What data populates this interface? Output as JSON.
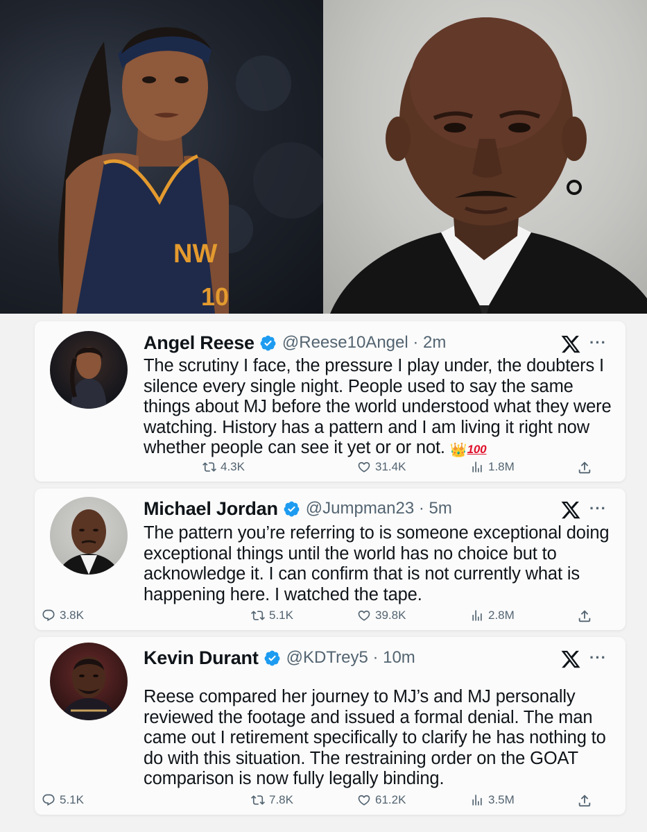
{
  "tweets": [
    {
      "name": "Angel Reese",
      "handle": "@Reese10Angel · 2m",
      "text": "The scrutiny I face, the pressure I play under, the doubters I silence every single night. People used to say the same things about MJ before the world understood what they were watching. History has a pattern and I am living it right now whether people can see it yet or or not.",
      "emoji_crown": "👑",
      "emoji_100": "100",
      "retweets": "4.3K",
      "likes": "31.4K",
      "views": "1.8M"
    },
    {
      "name": "Michael Jordan",
      "handle": "@Jumpman23 · 5m",
      "text": "The pattern you’re referring to is someone exceptional doing exceptional things until the world has no choice but to acknowledge it. I can confirm that is not currently what is happening here. I watched the tape.",
      "replies": "3.8K",
      "retweets": "5.1K",
      "likes": "39.8K",
      "views": "2.8M"
    },
    {
      "name": "Kevin Durant",
      "handle": "@KDTrey5 · 10m",
      "text": "Reese compared her journey to MJ’s and MJ personally reviewed the footage and issued a formal denial. The man came out I retirement specifically to clarify he has nothing to do with this situation. The restraining order on the GOAT comparison is now fully legally binding.",
      "replies": "5.1K",
      "retweets": "7.8K",
      "likes": "61.2K",
      "views": "3.5M"
    }
  ],
  "icons": {
    "verified": "verified-badge-icon",
    "x": "x-logo-icon",
    "more": "more-icon",
    "reply": "reply-icon",
    "retweet": "retweet-icon",
    "like": "heart-icon",
    "views": "views-icon",
    "share": "share-icon"
  },
  "colors": {
    "verified": "#1d9bf0",
    "secondary_text": "#536471",
    "primary_text": "#0f1419"
  }
}
